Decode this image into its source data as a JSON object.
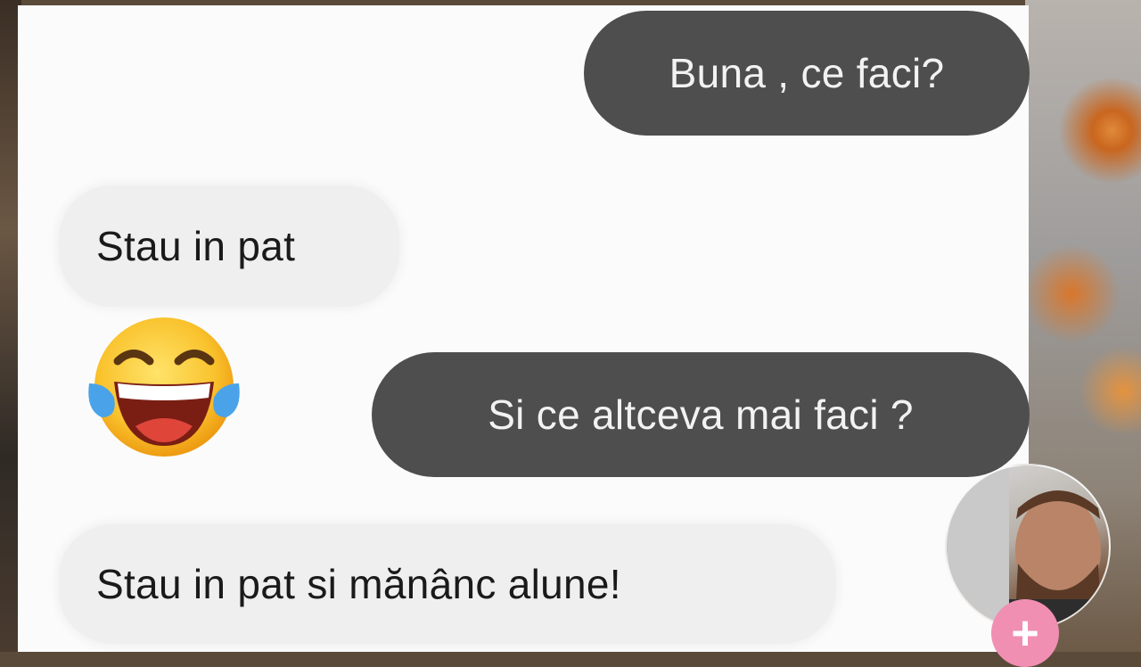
{
  "messages": [
    {
      "direction": "outgoing",
      "text": "Buna , ce faci?"
    },
    {
      "direction": "incoming",
      "text": "Stau in pat"
    },
    {
      "direction": "incoming",
      "emoji": "tears-of-joy-emoji"
    },
    {
      "direction": "outgoing",
      "text": "Si ce altceva mai faci ?"
    },
    {
      "direction": "incoming",
      "text": "Stau in pat si mănânc alune!"
    }
  ],
  "avatar": {
    "icon": "profile-photo",
    "add_label": "+"
  },
  "colors": {
    "outgoing_bubble": "#4e4e4e",
    "incoming_bubble": "#efefef",
    "chat_background": "#fbfbfb",
    "fab": "#f08fb1"
  }
}
